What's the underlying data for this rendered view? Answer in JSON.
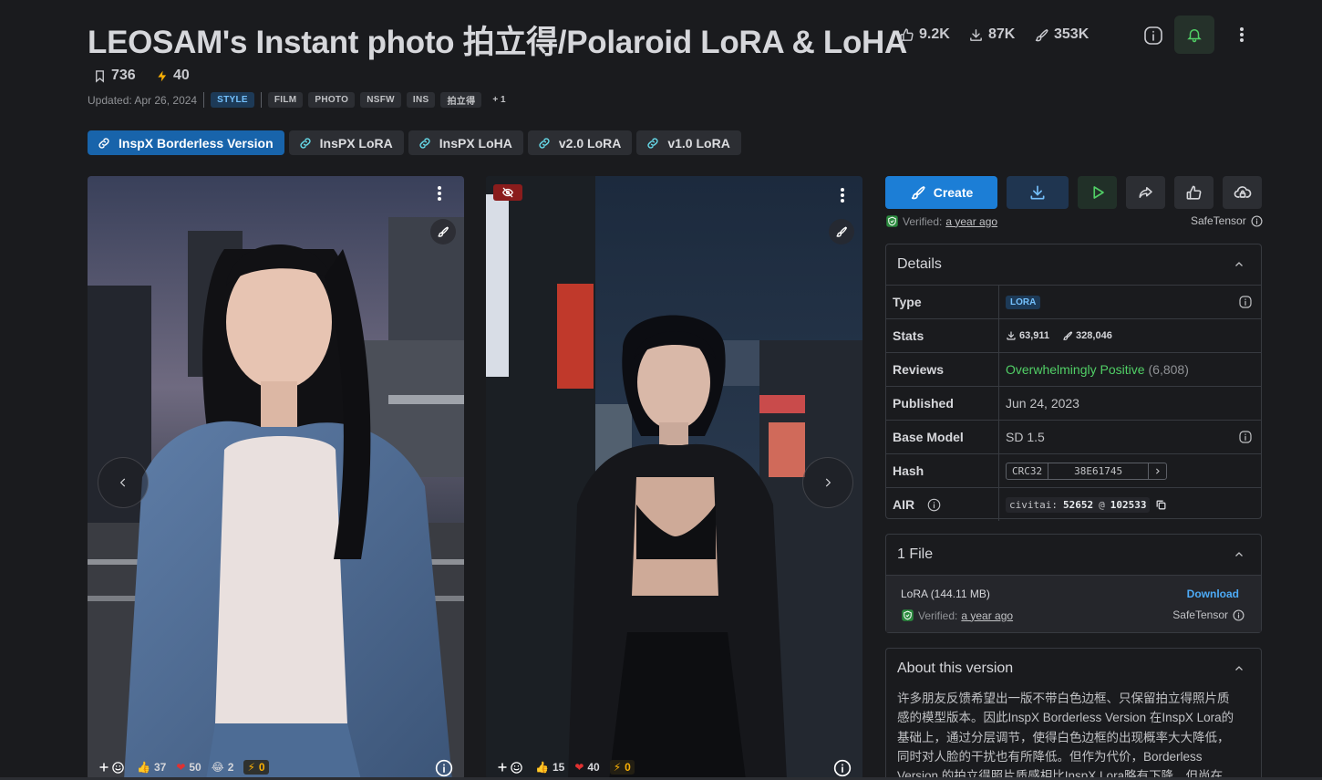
{
  "header": {
    "title": "LEOSAM's Instant photo 拍立得/Polaroid LoRA & LoHA",
    "likes": "9.2K",
    "downloads": "87K",
    "generations": "353K",
    "bookmarks": "736",
    "buzz": "40",
    "updated": "Updated: Apr 26, 2024",
    "tags": [
      "STYLE",
      "FILM",
      "PHOTO",
      "NSFW",
      "INS",
      "拍立得"
    ],
    "more_tags": "+ 1"
  },
  "versions": [
    "InspX Borderless Version",
    "InsPX LoRA",
    "InsPX LoHA",
    "v2.0 LoRA",
    "v1.0 LoRA"
  ],
  "gallery": [
    {
      "reactions": {
        "like": "37",
        "heart": "50",
        "laugh": "2",
        "buzz": "0"
      }
    },
    {
      "reactions": {
        "like": "15",
        "heart": "40",
        "buzz": "0"
      }
    }
  ],
  "actions": {
    "create_label": "Create",
    "verified_label": "Verified:",
    "verified_time": "a year ago",
    "safetensor": "SafeTensor"
  },
  "details": {
    "title": "Details",
    "type_label": "Type",
    "type_value": "LORA",
    "stats_label": "Stats",
    "stats_downloads": "63,911",
    "stats_generations": "328,046",
    "reviews_label": "Reviews",
    "reviews_value": "Overwhelmingly Positive",
    "reviews_count": "(6,808)",
    "published_label": "Published",
    "published_value": "Jun 24, 2023",
    "base_label": "Base Model",
    "base_value": "SD 1.5",
    "hash_label": "Hash",
    "hash_type": "CRC32",
    "hash_value": "38E61745",
    "air_label": "AIR",
    "air_prefix": "civitai:",
    "air_model": "52652",
    "air_at": "@",
    "air_version": "102533"
  },
  "files": {
    "title": "1 File",
    "file_name": "LoRA (144.11 MB)",
    "download_label": "Download",
    "verified_label": "Verified:",
    "verified_time": "a year ago",
    "safetensor": "SafeTensor"
  },
  "about": {
    "title": "About this version",
    "text": "许多朋友反馈希望出一版不带白色边框、只保留拍立得照片质感的模型版本。因此InspX Borderless Version 在InspX Lora的基础上，通过分层调节，使得白色边框的出现概率大大降低，同时对人脸的干扰也有所降低。但作为代价，Borderless Version 的拍立得照片质感相比InspX Lora略有下降，但尚在可"
  },
  "colors": {
    "accent": "#1c7ed6",
    "positive": "#51cf66",
    "bg": "#1a1b1e"
  }
}
